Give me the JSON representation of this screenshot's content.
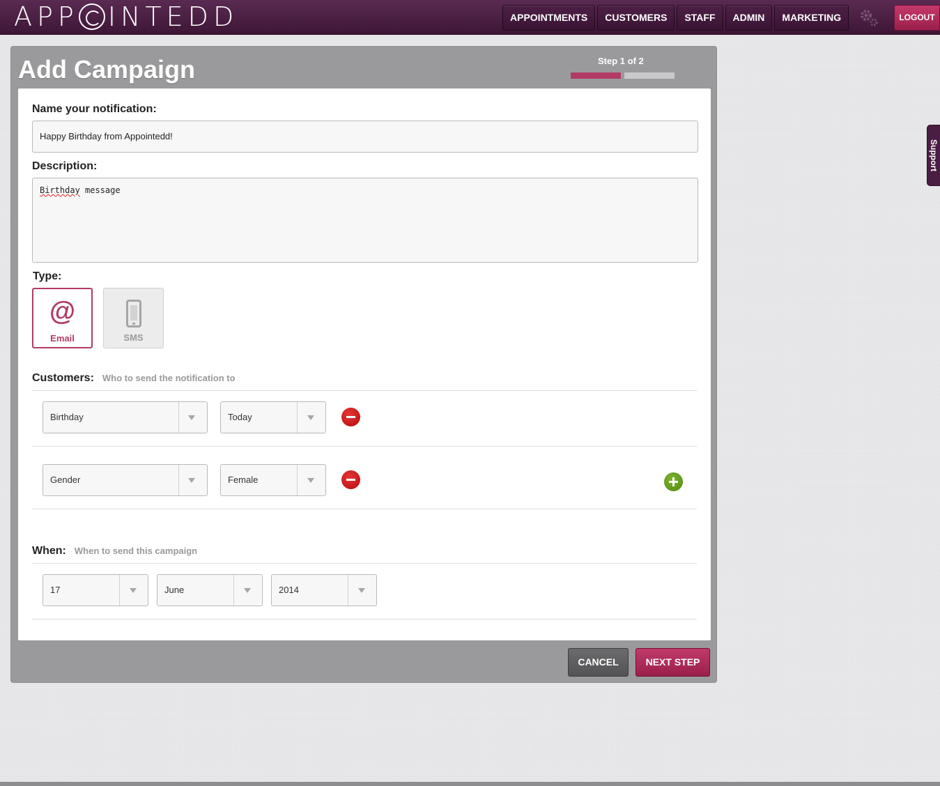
{
  "app": {
    "logo_text": "APPOINTEDD"
  },
  "nav": {
    "items": [
      {
        "label": "APPOINTMENTS"
      },
      {
        "label": "CUSTOMERS"
      },
      {
        "label": "STAFF"
      },
      {
        "label": "ADMIN"
      },
      {
        "label": "MARKETING"
      }
    ],
    "settings_icon": "gear-icon",
    "logout_label": "LOGOUT"
  },
  "support_label": "Support",
  "page": {
    "title": "Add Campaign",
    "step_label": "Step 1 of 2",
    "step_progress": {
      "current": 1,
      "total": 2
    }
  },
  "form": {
    "name_label": "Name your notification:",
    "name_value": "Happy Birthday from Appointedd!",
    "description_label": "Description:",
    "description_word1": "Birthday",
    "description_word2": " message",
    "type_label": "Type:",
    "types": [
      {
        "label": "Email",
        "icon": "at-icon",
        "selected": true
      },
      {
        "label": "SMS",
        "icon": "phone-icon",
        "selected": false
      }
    ],
    "customers_label": "Customers:",
    "customers_hint": "Who to send the notification to",
    "filters": [
      {
        "field": "Birthday",
        "value": "Today"
      },
      {
        "field": "Gender",
        "value": "Female"
      }
    ],
    "when_label": "When:",
    "when_hint": "When to send this campaign",
    "date": {
      "day": "17",
      "month": "June",
      "year": "2014"
    }
  },
  "actions": {
    "cancel_label": "CANCEL",
    "next_label": "NEXT STEP"
  },
  "colors": {
    "brand_purple": "#4a1d43",
    "accent_pink": "#b23a66",
    "remove_red": "#c91a1a",
    "add_green": "#5f9a1c"
  }
}
